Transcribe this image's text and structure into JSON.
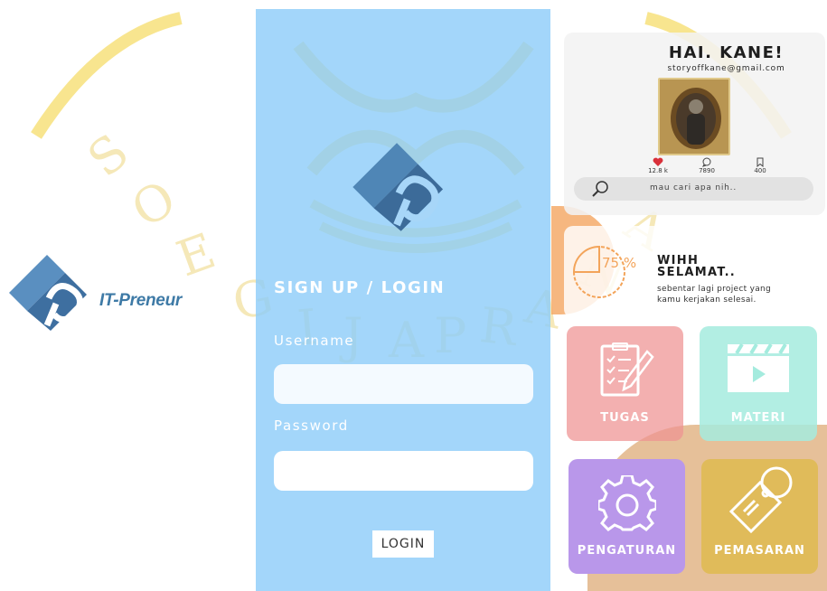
{
  "watermark": {
    "text": "SOEGIJAPRANATA",
    "color": "#f4d24a"
  },
  "left_logo": {
    "name": "IT-Preneur",
    "color": "#3e7aa6"
  },
  "login": {
    "title": "SIGN UP / LOGIN",
    "username_label": "Username",
    "username_value": "",
    "password_label": "Password",
    "password_value": "",
    "button_label": "LOGIN",
    "panel_color": "#8fcdf9"
  },
  "profile": {
    "greeting": "HAI. KANE!",
    "email": "storyoffkane@gmail.com",
    "stats": {
      "likes": "12.8 k",
      "comments": "7890",
      "saves": "400"
    }
  },
  "search": {
    "placeholder": "mau cari apa nih.."
  },
  "progress": {
    "percent": "75 %",
    "title_line1": "WIHH",
    "title_line2": "SELAMAT..",
    "description": "sebentar lagi project yang kamu kerjakan selesai."
  },
  "menu": {
    "tugas": {
      "label": "TUGAS",
      "color": "#ee9191"
    },
    "materi": {
      "label": "MATERI",
      "color": "#a4ebde"
    },
    "pengaturan": {
      "label": "PENGATURAN",
      "color": "#b997ea"
    },
    "pemasaran": {
      "label": "PEMASARAN",
      "color": "#e0bb5a"
    }
  }
}
